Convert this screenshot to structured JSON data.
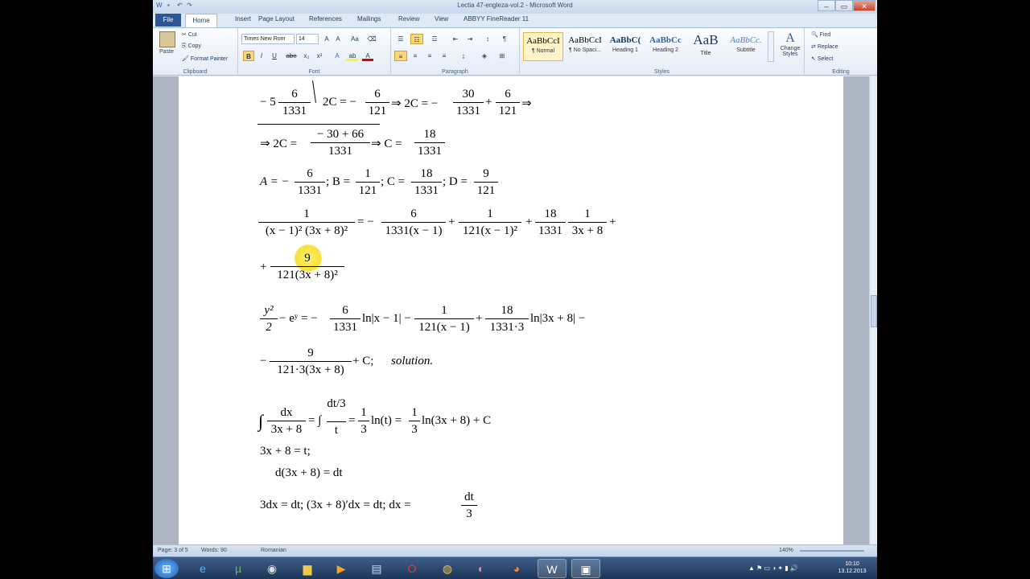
{
  "window": {
    "title": "Lectia 47-engleza-vol.2 - Microsoft Word"
  },
  "tabs": [
    "File",
    "Home",
    "Insert",
    "Page Layout",
    "References",
    "Mailings",
    "Review",
    "View",
    "ABBYY FineReader 11"
  ],
  "ribbon": {
    "clipboard": {
      "paste": "Paste",
      "cut": "Cut",
      "copy": "Copy",
      "format_painter": "Format Painter",
      "label": "Clipboard"
    },
    "font": {
      "family": "Times New Rom",
      "size": "14",
      "label": "Font"
    },
    "paragraph": {
      "label": "Paragraph"
    },
    "styles": {
      "items": [
        {
          "preview": "AaBbCcI",
          "name": "¶ Normal"
        },
        {
          "preview": "AaBbCcI",
          "name": "¶ No Spaci..."
        },
        {
          "preview": "AaBbC(",
          "name": "Heading 1"
        },
        {
          "preview": "AaBbCc",
          "name": "Heading 2"
        },
        {
          "preview": "AaB",
          "name": "Title"
        },
        {
          "preview": "AaBbCc.",
          "name": "Subtitle"
        }
      ],
      "change_styles": "Change Styles",
      "label": "Styles"
    },
    "editing": {
      "find": "Find",
      "replace": "Replace",
      "select": "Select",
      "label": "Editing"
    }
  },
  "document": {
    "lines": {
      "l1_a": "− 5",
      "l1_f1n": "6",
      "l1_f1d": "1331",
      "l1_b": "2C = −",
      "l1_f2n": "6",
      "l1_f2d": "121",
      "l1_c": "⇒ 2C = −",
      "l1_f3n": "30",
      "l1_f3d": "1331",
      "l1_d": "+",
      "l1_f4n": "6",
      "l1_f4d": "121",
      "l1_e": "⇒",
      "l2_a": "⇒ 2C =",
      "l2_fn": "− 30 + 66",
      "l2_fd": "1331",
      "l2_b": "⇒ C =",
      "l2_f2n": "18",
      "l2_f2d": "1331",
      "l3_a": "A = −",
      "l3_f1n": "6",
      "l3_f1d": "1331",
      "l3_b": "; B =",
      "l3_f2n": "1",
      "l3_f2d": "121",
      "l3_c": "; C =",
      "l3_f3n": "18",
      "l3_f3d": "1331",
      "l3_d": "; D =",
      "l3_f4n": "9",
      "l3_f4d": "121",
      "l4_f1n": "1",
      "l4_f1d": "(x − 1)² (3x + 8)²",
      "l4_a": "= −",
      "l4_f2n": "6",
      "l4_f2d": "1331(x − 1)",
      "l4_b": "+",
      "l4_f3n": "1",
      "l4_f3d": "121(x − 1)²",
      "l4_c": "+",
      "l4_f4n": "18",
      "l4_f4d": "1331",
      "l4_f5n": "1",
      "l4_f5d": "3x + 8",
      "l4_d": "+",
      "l5_a": "+",
      "l5_fn": "9",
      "l5_fd": "121(3x + 8)²",
      "l6_f1n": "y²",
      "l6_f1d": "2",
      "l6_a": "− eʸ = −",
      "l6_f2n": "6",
      "l6_f2d": "1331",
      "l6_b": "ln|x − 1| −",
      "l6_f3n": "1",
      "l6_f3d": "121(x − 1)",
      "l6_c": "+",
      "l6_f4n": "18",
      "l6_f4d": "1331·3",
      "l6_d": "ln|3x + 8| −",
      "l7_a": "−",
      "l7_fn": "9",
      "l7_fd": "121·3(3x + 8)",
      "l7_b": "+ C;",
      "l7_c": "solution.",
      "l8_int1": "∫",
      "l8_f1n": "dx",
      "l8_f1d": "3x + 8",
      "l8_a": "= ∫",
      "l8_f2n": "dt/3",
      "l8_f2d": "t",
      "l8_b": "=",
      "l8_f3n": "1",
      "l8_f3d": "3",
      "l8_c": "ln(t) =",
      "l8_f4n": "1",
      "l8_f4d": "3",
      "l8_d": "ln(3x + 8) + C",
      "l9": "3x + 8 = t;",
      "l10": "d(3x + 8) = dt",
      "l11_a": "3dx = dt;    (3x + 8)′dx = dt;    dx =",
      "l11_fn": "dt",
      "l11_fd": "3"
    }
  },
  "status": {
    "page": "Page: 3 of 5",
    "words": "Words: 90",
    "language": "Romanian",
    "zoom": "140%"
  },
  "clock": {
    "time": "10:10",
    "date": "13.12.2013"
  }
}
